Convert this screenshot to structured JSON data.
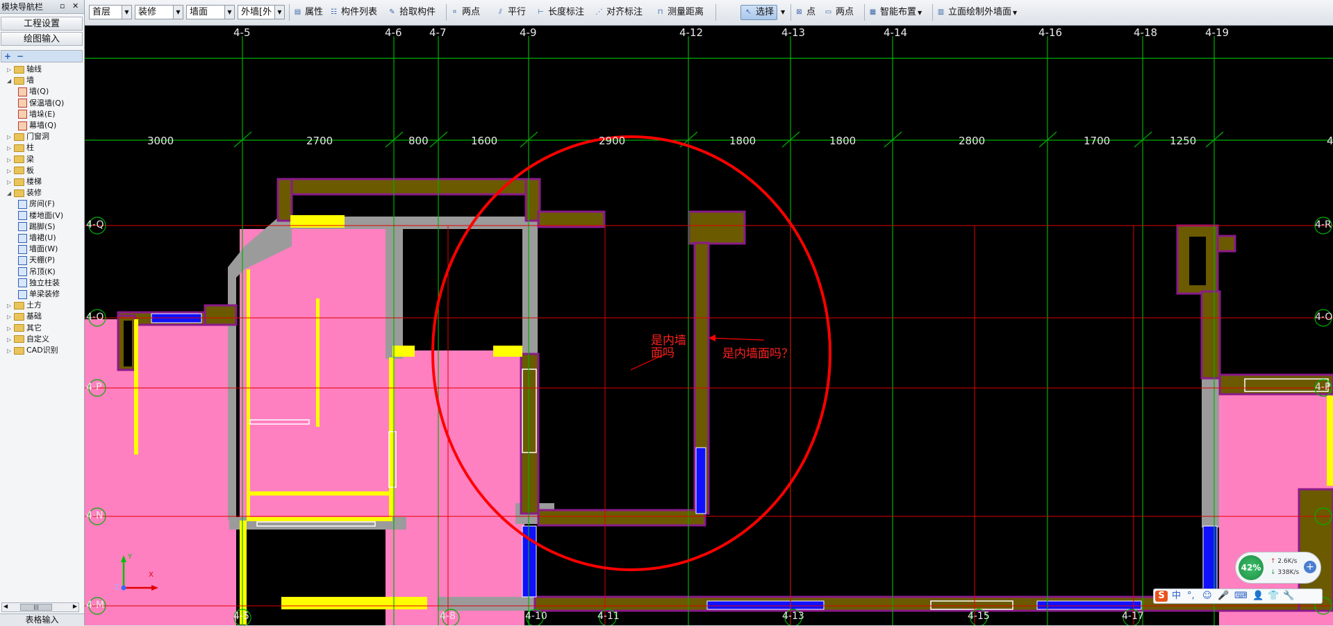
{
  "left_panel": {
    "title": "模块导航栏",
    "pin_label": "▫",
    "close_label": "✕",
    "nav_buttons": [
      "工程设置",
      "绘图输入"
    ],
    "tree_toolbar": [
      "+",
      "−"
    ],
    "tree": [
      {
        "label": "轴线",
        "level": 0,
        "icon": "folder-icon",
        "expanded": false
      },
      {
        "label": "墙",
        "level": 0,
        "icon": "folder-icon",
        "expanded": true
      },
      {
        "label": "墙(Q)",
        "level": 1,
        "icon": "wall-icon"
      },
      {
        "label": "保温墙(Q)",
        "level": 1,
        "icon": "insulation-wall-icon"
      },
      {
        "label": "墙垛(E)",
        "level": 1,
        "icon": "wall-pier-icon"
      },
      {
        "label": "幕墙(Q)",
        "level": 1,
        "icon": "curtain-wall-icon"
      },
      {
        "label": "门窗洞",
        "level": 0,
        "icon": "folder-icon",
        "expanded": false
      },
      {
        "label": "柱",
        "level": 0,
        "icon": "folder-icon",
        "expanded": false
      },
      {
        "label": "梁",
        "level": 0,
        "icon": "folder-icon",
        "expanded": false
      },
      {
        "label": "板",
        "level": 0,
        "icon": "folder-icon",
        "expanded": false
      },
      {
        "label": "楼梯",
        "level": 0,
        "icon": "folder-icon",
        "expanded": false
      },
      {
        "label": "装修",
        "level": 0,
        "icon": "folder-icon",
        "expanded": true
      },
      {
        "label": "房间(F)",
        "level": 1,
        "icon": "room-icon"
      },
      {
        "label": "楼地面(V)",
        "level": 1,
        "icon": "floor-icon"
      },
      {
        "label": "踢脚(S)",
        "level": 1,
        "icon": "skirting-icon"
      },
      {
        "label": "墙裙(U)",
        "level": 1,
        "icon": "dado-icon"
      },
      {
        "label": "墙面(W)",
        "level": 1,
        "icon": "wall-surface-icon"
      },
      {
        "label": "天棚(P)",
        "level": 1,
        "icon": "ceiling-icon"
      },
      {
        "label": "吊顶(K)",
        "level": 1,
        "icon": "suspended-ceiling-icon"
      },
      {
        "label": "独立柱装",
        "level": 1,
        "icon": "column-finish-icon"
      },
      {
        "label": "单梁装修",
        "level": 1,
        "icon": "beam-finish-icon"
      },
      {
        "label": "土方",
        "level": 0,
        "icon": "folder-icon",
        "expanded": false
      },
      {
        "label": "基础",
        "level": 0,
        "icon": "folder-icon",
        "expanded": false
      },
      {
        "label": "其它",
        "level": 0,
        "icon": "folder-icon",
        "expanded": false
      },
      {
        "label": "自定义",
        "level": 0,
        "icon": "folder-icon",
        "expanded": false
      },
      {
        "label": "CAD识别",
        "level": 0,
        "icon": "folder-icon",
        "expanded": false
      }
    ],
    "scroll_thumb": "|||",
    "bottom_label": "表格输入"
  },
  "toolbar": {
    "floor": "首层",
    "category": "装修",
    "element_type": "墙面",
    "element_name": "外墙[外",
    "properties": "属性",
    "component_list": "构件列表",
    "pick_component": "拾取构件",
    "two_points": "两点",
    "parallel": "平行",
    "length_dim": "长度标注",
    "align_dim": "对齐标注",
    "measure": "测量距离",
    "select": "选择",
    "point": "点",
    "two_points_2": "两点",
    "smart_layout": "智能布置",
    "elevation_draw": "立面绘制外墙面"
  },
  "drawing": {
    "top_axes": [
      "4-5",
      "4-6",
      "4-7",
      "4-9",
      "4-12",
      "4-13",
      "4-14",
      "4-16",
      "4-18",
      "4-19"
    ],
    "dimensions": [
      "3000",
      "2700",
      "800",
      "1600",
      "2900",
      "1800",
      "1800",
      "2800",
      "1700",
      "1250",
      "4"
    ],
    "left_axes": [
      "4-Q",
      "4-O",
      "4-P",
      "4-N",
      "4-M"
    ],
    "right_axes": [
      "4-R",
      "4-O",
      "4-P"
    ],
    "bottom_axes": [
      "4-5",
      "4-8",
      "4-10",
      "4-11",
      "4-13",
      "4-15",
      "4-17"
    ],
    "annotation_1": "是内墙面吗",
    "annotation_2": "是内墙面吗？",
    "axis_y_label": "Y",
    "axis_x_label": "X",
    "axis_z_label": "Z"
  },
  "widgets": {
    "cpu_percent": "42%",
    "upload_speed": "2.6K/s",
    "download_speed": "338K/s",
    "ime_labels": [
      "S",
      "中",
      "°,",
      "☺",
      "🎤",
      "⌨",
      "👤",
      "👕",
      "🔧"
    ]
  },
  "colors": {
    "canvas_bg": "#000000",
    "room_fill": "#ff80c0",
    "wall_gray": "#9b9b9b",
    "wall_olive": "#6b5a00",
    "wall_outline": "#8a1a8a",
    "finish_yellow": "#ffff00",
    "window_blue": "#0000ff",
    "grid_green": "#00b000",
    "grid_red": "#e00000",
    "question_circle": "#ff0000"
  }
}
